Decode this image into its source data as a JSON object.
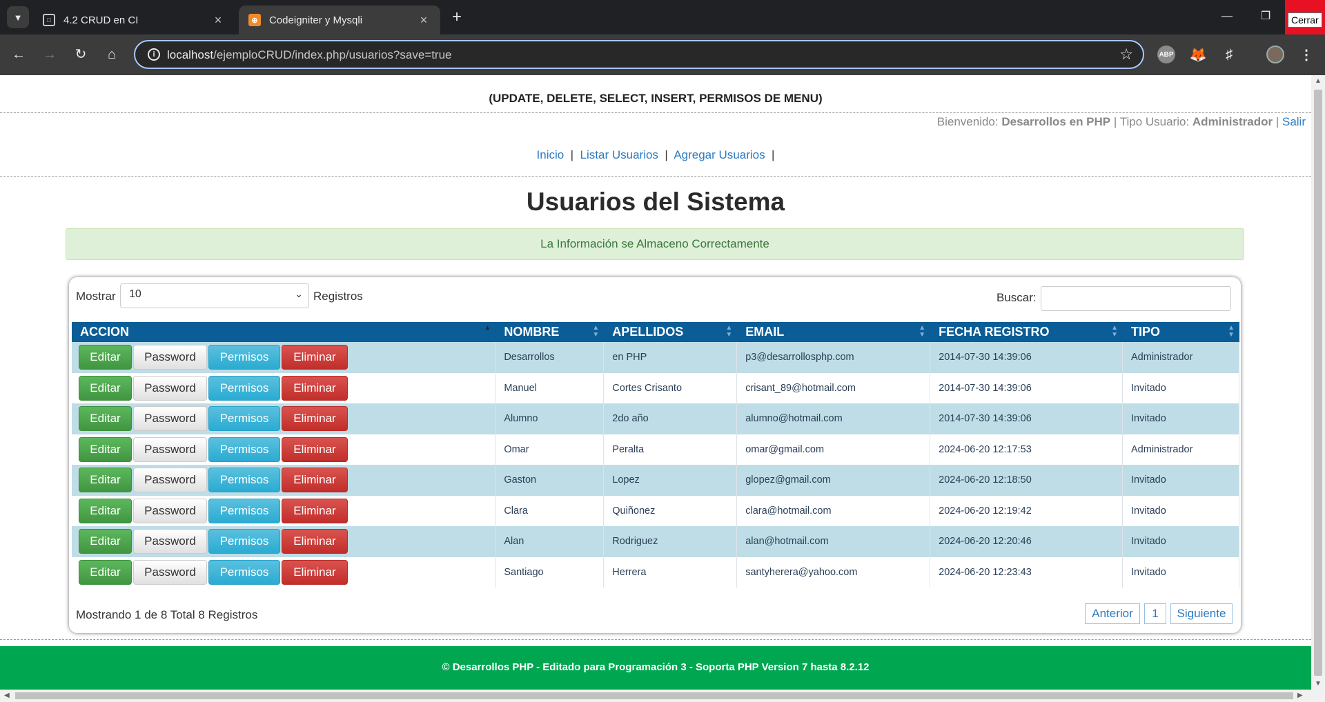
{
  "browser": {
    "tabs": [
      {
        "title": "4.2 CRUD en CI",
        "active": false
      },
      {
        "title": "Codeigniter y Mysqli",
        "active": true
      }
    ],
    "url_host": "localhost",
    "url_path": "/ejemploCRUD/index.php/usuarios?save=true",
    "tooltip": "Cerrar"
  },
  "header": {
    "subtitle": "(UPDATE, DELETE, SELECT, INSERT, PERMISOS DE MENU)",
    "welcome_label": "Bienvenido:",
    "user_name": "Desarrollos en PHP",
    "type_label": "Tipo Usuario:",
    "user_type": "Administrador",
    "logout": "Salir",
    "sep": "|"
  },
  "nav": [
    {
      "label": "Inicio"
    },
    {
      "label": "Listar Usuarios"
    },
    {
      "label": "Agregar Usuarios"
    }
  ],
  "page_title": "Usuarios del Sistema",
  "alert": "La Información se Almaceno Correctamente",
  "table_controls": {
    "show_label": "Mostrar",
    "page_size": "10",
    "records_label": "Registros",
    "search_label": "Buscar:",
    "search_value": ""
  },
  "columns": [
    "ACCION",
    "NOMBRE",
    "APELLIDOS",
    "EMAIL",
    "FECHA REGISTRO",
    "TIPO"
  ],
  "actions": {
    "edit": "Editar",
    "password": "Password",
    "permisos": "Permisos",
    "delete": "Eliminar"
  },
  "rows": [
    {
      "nombre": "Desarrollos",
      "apellidos": "en PHP",
      "email": "p3@desarrollosphp.com",
      "fecha": "2014-07-30 14:39:06",
      "tipo": "Administrador"
    },
    {
      "nombre": "Manuel",
      "apellidos": "Cortes Crisanto",
      "email": "crisant_89@hotmail.com",
      "fecha": "2014-07-30 14:39:06",
      "tipo": "Invitado"
    },
    {
      "nombre": "Alumno",
      "apellidos": "2do año",
      "email": "alumno@hotmail.com",
      "fecha": "2014-07-30 14:39:06",
      "tipo": "Invitado"
    },
    {
      "nombre": "Omar",
      "apellidos": "Peralta",
      "email": "omar@gmail.com",
      "fecha": "2024-06-20 12:17:53",
      "tipo": "Administrador"
    },
    {
      "nombre": "Gaston",
      "apellidos": "Lopez",
      "email": "glopez@gmail.com",
      "fecha": "2024-06-20 12:18:50",
      "tipo": "Invitado"
    },
    {
      "nombre": "Clara",
      "apellidos": "Quiñonez",
      "email": "clara@hotmail.com",
      "fecha": "2024-06-20 12:19:42",
      "tipo": "Invitado"
    },
    {
      "nombre": "Alan",
      "apellidos": "Rodriguez",
      "email": "alan@hotmail.com",
      "fecha": "2024-06-20 12:20:46",
      "tipo": "Invitado"
    },
    {
      "nombre": "Santiago",
      "apellidos": "Herrera",
      "email": "santyherera@yahoo.com",
      "fecha": "2024-06-20 12:23:43",
      "tipo": "Invitado"
    }
  ],
  "footer_info": "Mostrando 1 de 8 Total 8 Registros",
  "pagination": {
    "prev": "Anterior",
    "page": "1",
    "next": "Siguiente"
  },
  "footer": "© Desarrollos PHP - Editado para Programación 3 - Soporta PHP Version 7 hasta 8.2.12",
  "colors": {
    "header_blue": "#0a5d97",
    "row_alt": "#bedde6",
    "footer_green": "#00a650",
    "alert_bg": "#dff0d8"
  }
}
